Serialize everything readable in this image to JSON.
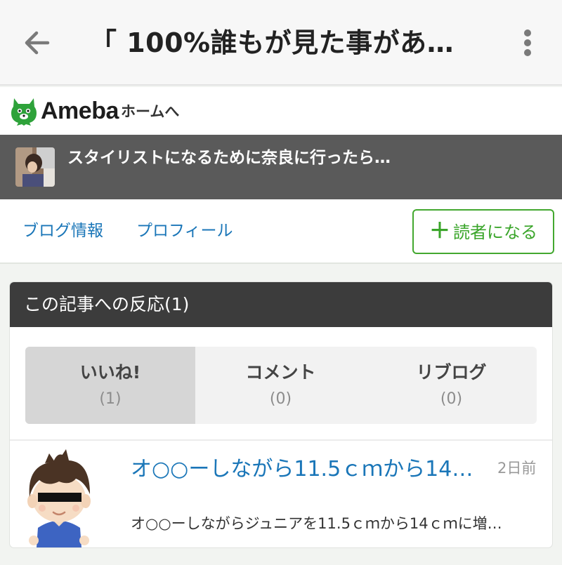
{
  "appbar": {
    "title": "「 100%誰もが見た事があ…",
    "back_icon": "arrow-left-icon",
    "more_icon": "more-vertical-icon"
  },
  "ameba": {
    "logo_text": "Ameba",
    "home_link": "ホームへ",
    "logo_color": "#2ea23a"
  },
  "blog": {
    "title": "スタイリストになるために奈良に行ったら…"
  },
  "nav": {
    "blog_info": "ブログ情報",
    "profile": "プロフィール",
    "follow_label": "読者になる",
    "follow_icon": "plus-icon",
    "link_color": "#1a76b8",
    "accent_color": "#43a82f"
  },
  "reactions": {
    "header": "この記事への反応(1)",
    "tabs": [
      {
        "label": "いいね!",
        "count": "(1)",
        "active": true
      },
      {
        "label": "コメント",
        "count": "(0)",
        "active": false
      },
      {
        "label": "リブログ",
        "count": "(0)",
        "active": false
      }
    ],
    "items": [
      {
        "title": "オ○○ーしながら11.5ｃｍから14…",
        "time": "2日前",
        "snippet": "オ○○ーしながらジュニアを11.5ｃｍから14ｃｍに増…"
      }
    ]
  }
}
